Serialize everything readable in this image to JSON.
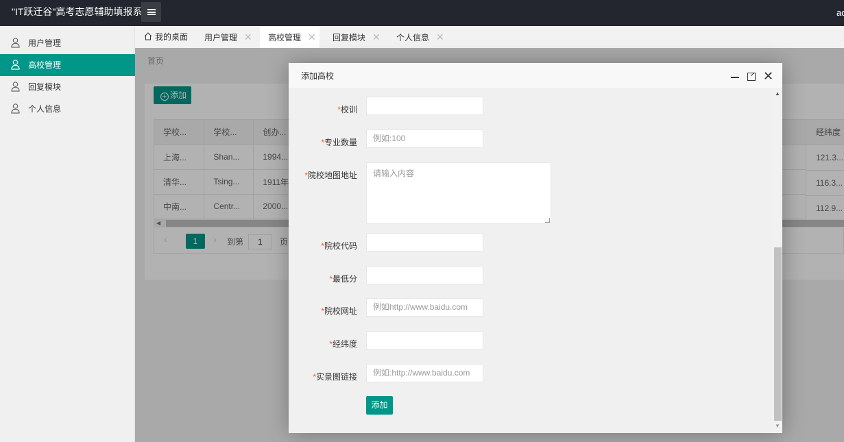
{
  "header": {
    "logo": "\"IT跃迁谷\"高考志愿辅助填报系",
    "user": "admin"
  },
  "sidebar": {
    "items": [
      {
        "label": "用户管理"
      },
      {
        "label": "高校管理"
      },
      {
        "label": "回复模块"
      },
      {
        "label": "个人信息"
      }
    ],
    "active": "高校管理"
  },
  "tabs": [
    {
      "label": "我的桌面"
    },
    {
      "label": "用户管理"
    },
    {
      "label": "高校管理"
    },
    {
      "label": "回复模块"
    },
    {
      "label": "个人信息"
    }
  ],
  "main": {
    "breadcrumb": "首页",
    "add_button": "添加",
    "table": {
      "headers": [
        "学校...",
        "学校...",
        "创办..."
      ],
      "rows": [
        [
          "上海...",
          "Shan...",
          "1994..."
        ],
        [
          "清华...",
          "Tsing...",
          "1911年"
        ],
        [
          "中南...",
          "Centr...",
          "2000..."
        ]
      ],
      "right_header": "经纬度",
      "right_values": [
        "121.3...",
        "116.3...",
        "112.9..."
      ]
    },
    "pager": {
      "current": "1",
      "goto_label": "到第",
      "input_value": "1",
      "unit": "页"
    }
  },
  "modal": {
    "title": "添加高校",
    "fields": {
      "motto": {
        "label": "校训",
        "placeholder": ""
      },
      "major_count": {
        "label": "专业数量",
        "placeholder": "例如:100"
      },
      "map_address": {
        "label": "院校地图地址",
        "placeholder": "请输入内容"
      },
      "code": {
        "label": "院校代码",
        "placeholder": ""
      },
      "min_score": {
        "label": "最低分",
        "placeholder": ""
      },
      "website": {
        "label": "院校网址",
        "placeholder": "例如http://www.baidu.com"
      },
      "coordinates": {
        "label": "经纬度",
        "placeholder": ""
      },
      "photo_link": {
        "label": "实景图链接",
        "placeholder": "例如:http://www.baidu.com"
      }
    },
    "submit": "添加"
  },
  "colors": {
    "accent": "#009688",
    "header_bg": "#23262e",
    "required": "#ff5722"
  }
}
